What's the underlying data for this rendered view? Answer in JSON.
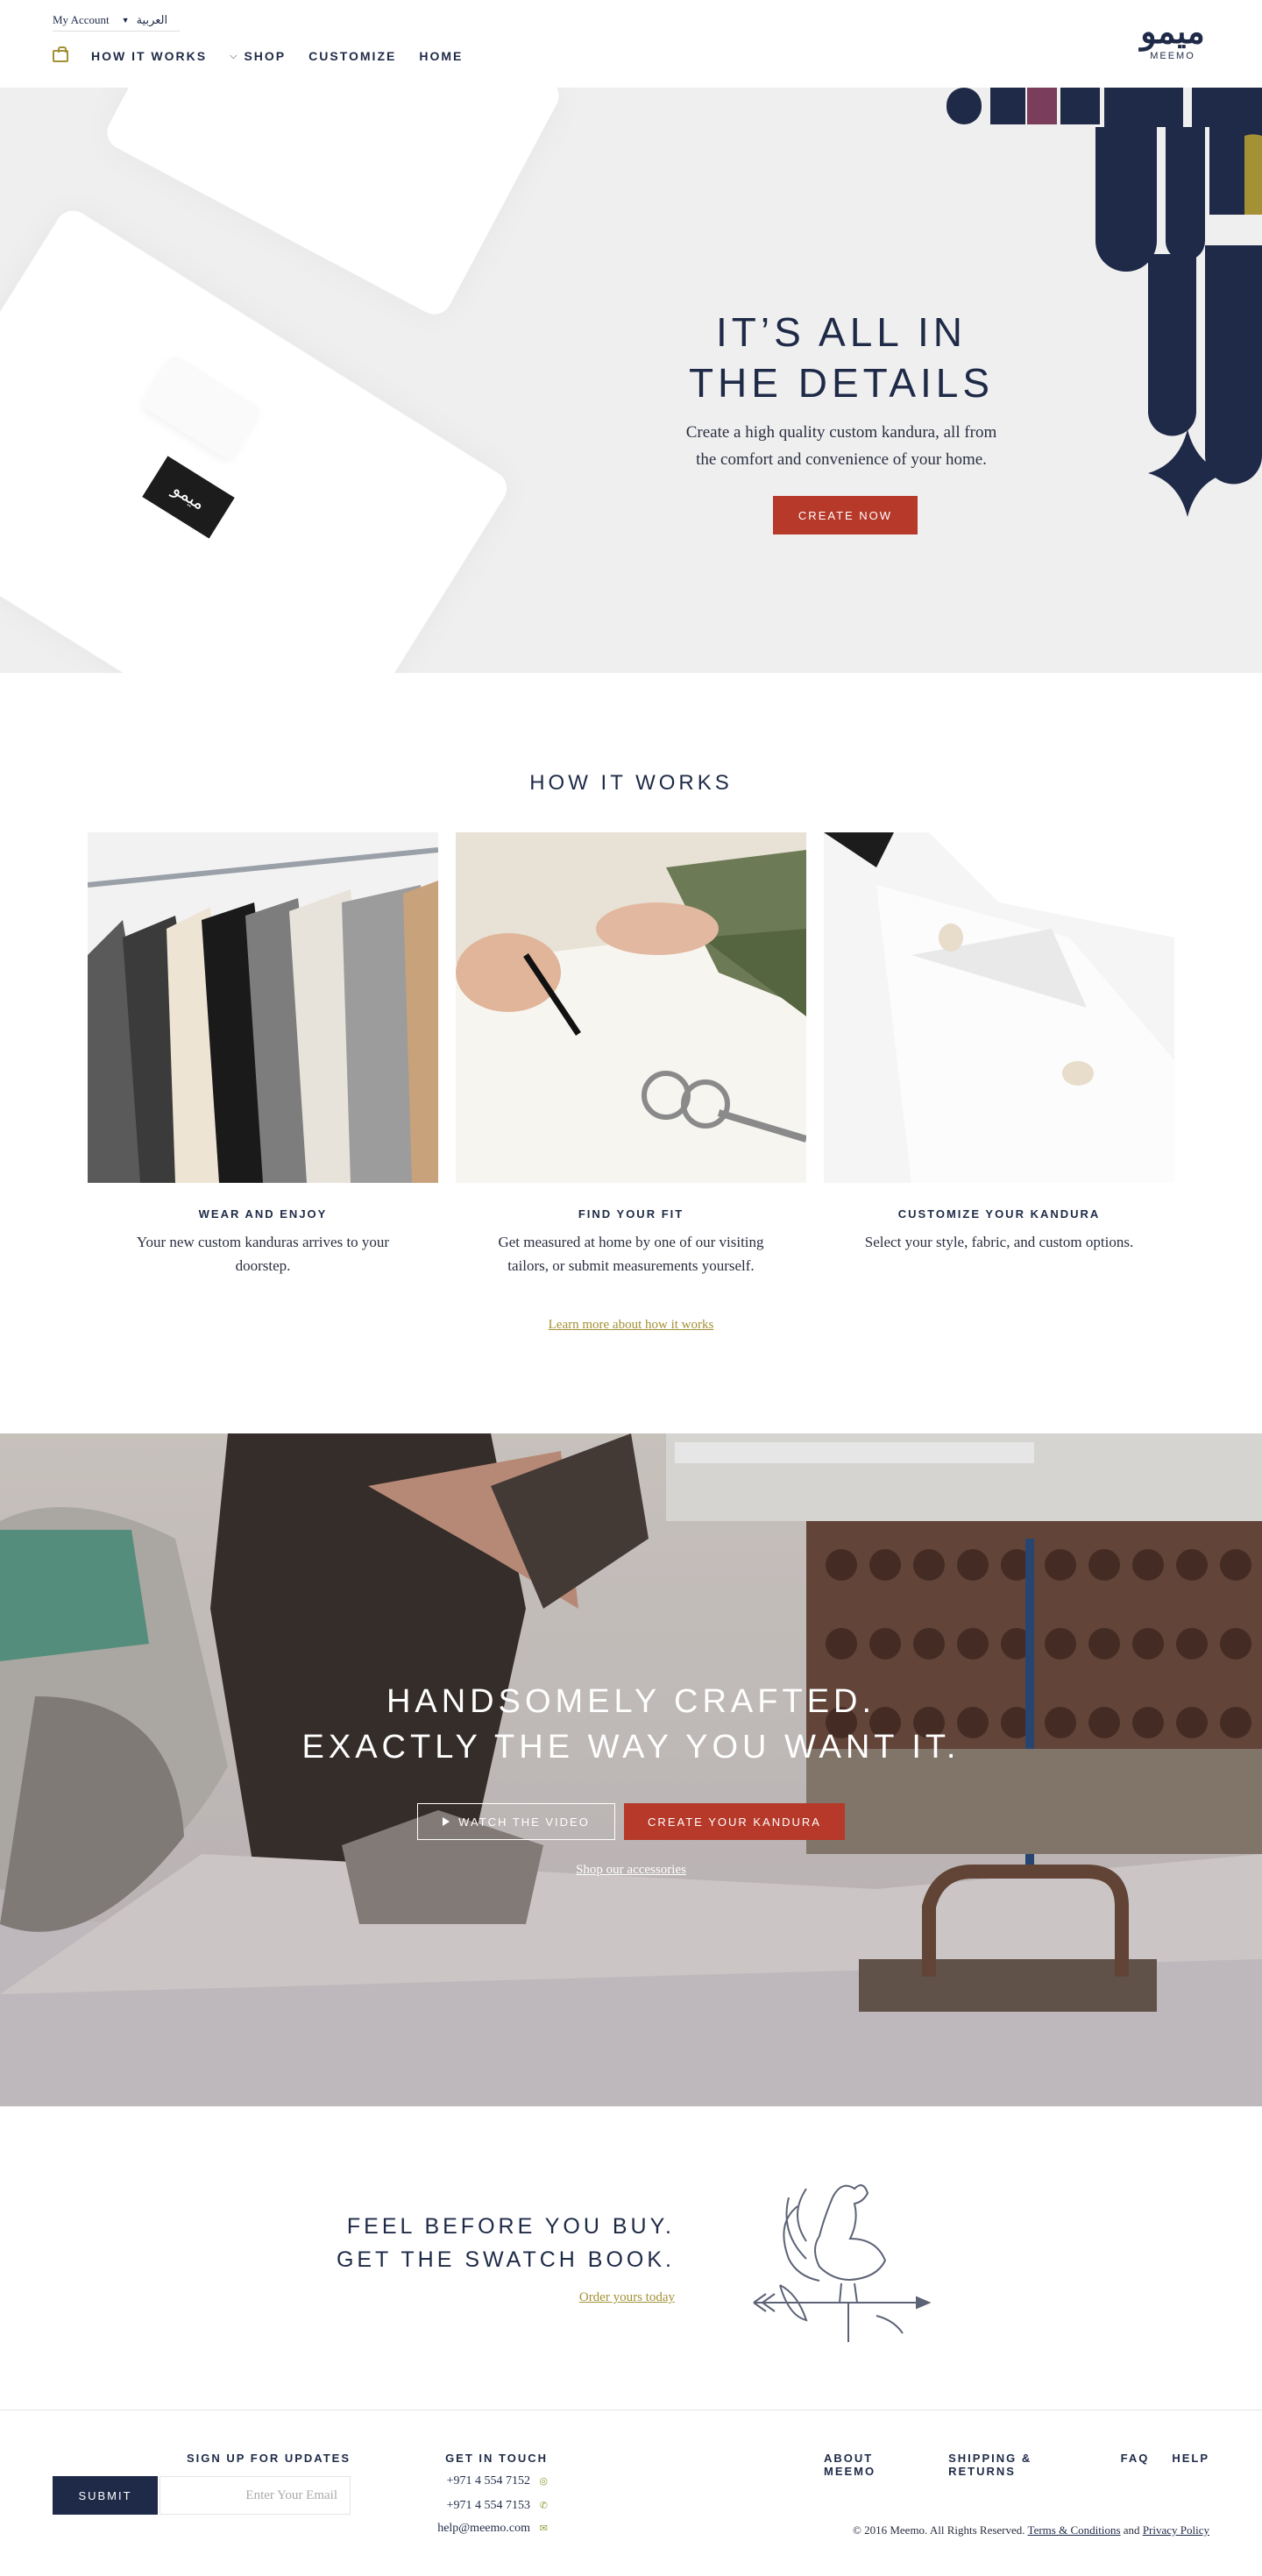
{
  "header": {
    "account_label": "My Account",
    "language_label": "العربية",
    "nav": {
      "how_it_works": "HOW IT WORKS",
      "shop": "SHOP",
      "customize": "CUSTOMIZE",
      "home": "HOME"
    },
    "logo_mark": "ميمو",
    "logo_word": "MEEMO",
    "icons": {
      "cart": "shopping-bag-icon",
      "dropdown": "chevron-down-icon"
    }
  },
  "hero": {
    "title_line1": "IT’S ALL IN",
    "title_line2": "THE DETAILS",
    "subtitle_line1": "Create a high quality custom kandura, all from",
    "subtitle_line2": "the comfort and convenience of your home.",
    "cta": "CREATE NOW",
    "label_text": "ميمو"
  },
  "how_it_works": {
    "title": "HOW IT WORKS",
    "steps": [
      {
        "title": "WEAR AND ENJOY",
        "text": "Your new custom kanduras arrives to your doorstep."
      },
      {
        "title": "FIND YOUR FIT",
        "text": "Get measured at home by one of our visiting tailors, or submit measurements yourself."
      },
      {
        "title": "CUSTOMIZE YOUR KANDURA",
        "text": "Select your style, fabric, and custom options."
      }
    ],
    "learn_more": "Learn more about how it works"
  },
  "crafted": {
    "title_line1": "HANDSOMELY CRAFTED.",
    "title_line2": "EXACTLY THE WAY YOU WANT IT.",
    "watch_video": "WATCH THE VIDEO",
    "create_kandura": "CREATE YOUR KANDURA",
    "accessories_link": "Shop our accessories"
  },
  "swatch": {
    "title_line1": "FEEL BEFORE YOU BUY.",
    "title_line2": "GET THE SWATCH BOOK.",
    "order_link": "Order yours today"
  },
  "footer": {
    "signup_heading": "SIGN UP FOR UPDATES",
    "submit": "SUBMIT",
    "email_placeholder": "Enter Your Email",
    "contact_heading": "GET IN TOUCH",
    "whatsapp": "+971 4 554 7152",
    "phone": "+971 4 554 7153",
    "email": "help@meemo.com",
    "links": [
      "ABOUT MEEMO",
      "SHIPPING & RETURNS",
      "FAQ",
      "HELP"
    ],
    "copyright": "© 2016 Meemo. All Rights Reserved.",
    "terms": "Terms & Conditions",
    "and": "and",
    "privacy": "Privacy Policy"
  },
  "colors": {
    "navy": "#1e2a47",
    "accent_red": "#b6392a",
    "gold": "#a49136",
    "hero_bg": "#efefef"
  }
}
